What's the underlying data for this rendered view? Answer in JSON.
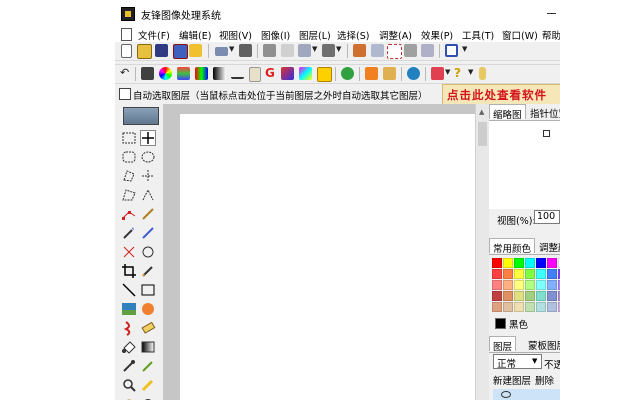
{
  "window": {
    "title": "友锋图像处理系统"
  },
  "menu": [
    {
      "label": "文件(F)"
    },
    {
      "label": "编辑(E)"
    },
    {
      "label": "视图(V)"
    },
    {
      "label": "图像(I)"
    },
    {
      "label": "图层(L)"
    },
    {
      "label": "选择(S)"
    },
    {
      "label": "调整(A)"
    },
    {
      "label": "效果(P)"
    },
    {
      "label": "工具(T)"
    },
    {
      "label": "窗口(W)"
    },
    {
      "label": "帮助"
    }
  ],
  "options_bar": {
    "auto_select_label": "自动选取图层（当鼠标点击处位于当前图层之外时自动选取其它图层）",
    "auto_select_checked": false,
    "promo_text": "点击此处查看软件"
  },
  "right_panel": {
    "top_tabs": [
      {
        "label": "缩略图"
      },
      {
        "label": "指针位置"
      }
    ],
    "zoom_label": "视图(%):",
    "zoom_value": "100",
    "color_tabs": [
      {
        "label": "常用颜色"
      },
      {
        "label": "调整颜色"
      }
    ],
    "palette": [
      "#ff0000",
      "#ffff00",
      "#00ff00",
      "#00ffff",
      "#0000ff",
      "#ff00ff",
      "#ffffff",
      "#c0c0c0",
      "#808080",
      "#ff4040",
      "#ff8040",
      "#ffff40",
      "#80ff40",
      "#40ffff",
      "#4080ff",
      "#8040ff",
      "#ff40ff",
      "#606060",
      "#ff8080",
      "#ffb080",
      "#ffff80",
      "#b0ff80",
      "#80ffff",
      "#80b0ff",
      "#b080ff",
      "#ff80ff",
      "#a0a0a0",
      "#c04040",
      "#e09060",
      "#e0e080",
      "#a0d080",
      "#80e0d0",
      "#8090d0",
      "#b090d0",
      "#e0a0c0",
      "#c0c0c0",
      "#e0a080",
      "#e0c0a0",
      "#f0e0b0",
      "#c0e0b0",
      "#b0e0e0",
      "#b0c0e0",
      "#d0b0e0",
      "#f0c0d0",
      "#e0e0e0"
    ],
    "foreground_color": "#000000",
    "foreground_label": "黑色",
    "layer_tabs": [
      {
        "label": "图层"
      },
      {
        "label": "蒙板图层"
      }
    ],
    "blend_mode": "正常",
    "opacity_label": "不透",
    "new_layer_label": "新建图层",
    "delete_label": "删除"
  },
  "icons": {
    "toolbar1": [
      "new-file-icon",
      "open-folder-icon",
      "save-icon",
      "save-as-icon",
      "scan-icon",
      "print-icon",
      "cut-icon",
      "copy-icon",
      "paste-icon",
      "image-size-icon",
      "canvas-icon",
      "crop-icon",
      "brush-icon",
      "frame-icon"
    ],
    "toolbar2": [
      "undo-icon",
      "camera-icon",
      "color-wheel-icon",
      "gradient-icon",
      "bars-icon",
      "curves-icon",
      "text-icon",
      "g-icon",
      "color-icon",
      "fill-icon",
      "cube-icon",
      "search-icon",
      "puzzle-icon",
      "globe-icon",
      "spotlight-icon",
      "hint-icon",
      "info-icon"
    ]
  }
}
